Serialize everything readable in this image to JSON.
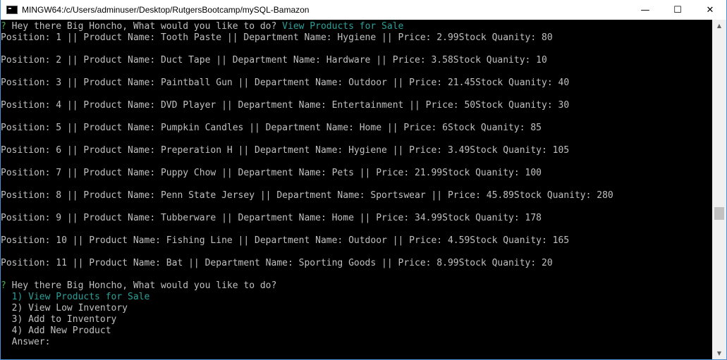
{
  "window": {
    "title": "MINGW64:/c/Users/adminuser/Desktop/RutgersBootcamp/mySQL-Bamazon",
    "minimize": "—",
    "maximize": "☐",
    "close": "✕"
  },
  "prompt": {
    "marker": "?",
    "question": "Hey there Big Honcho, What would you like to do?",
    "answer": "View Products for Sale"
  },
  "products": [
    "Position: 1 || Product Name: Tooth Paste || Department Name: Hygiene || Price: 2.99Stock Quanity: 80",
    "Position: 2 || Product Name: Duct Tape || Department Name: Hardware || Price: 3.58Stock Quanity: 10",
    "Position: 3 || Product Name: Paintball Gun || Department Name: Outdoor || Price: 21.45Stock Quanity: 40",
    "Position: 4 || Product Name: DVD Player || Department Name: Entertainment || Price: 50Stock Quanity: 30",
    "Position: 5 || Product Name: Pumpkin Candles || Department Name: Home || Price: 6Stock Quanity: 85",
    "Position: 6 || Product Name: Preperation H || Department Name: Hygiene || Price: 3.49Stock Quanity: 105",
    "Position: 7 || Product Name: Puppy Chow || Department Name: Pets || Price: 21.99Stock Quanity: 100",
    "Position: 8 || Product Name: Penn State Jersey || Department Name: Sportswear || Price: 45.89Stock Quanity: 280",
    "Position: 9 || Product Name: Tubberware || Department Name: Home || Price: 34.99Stock Quanity: 178",
    "Position: 10 || Product Name: Fishing Line || Department Name: Outdoor || Price: 4.59Stock Quanity: 165",
    "Position: 11 || Product Name: Bat || Department Name: Sporting Goods || Price: 8.99Stock Quanity: 20"
  ],
  "menu": {
    "options": [
      "  1) View Products for Sale",
      "  2) View Low Inventory",
      "  3) Add to Inventory",
      "  4) Add New Product"
    ],
    "answer_label": "  Answer:"
  },
  "colors": {
    "background": "#000000",
    "text": "#c0c0c0",
    "highlight": "#2aa198",
    "prompt_marker": "#4caf50"
  }
}
